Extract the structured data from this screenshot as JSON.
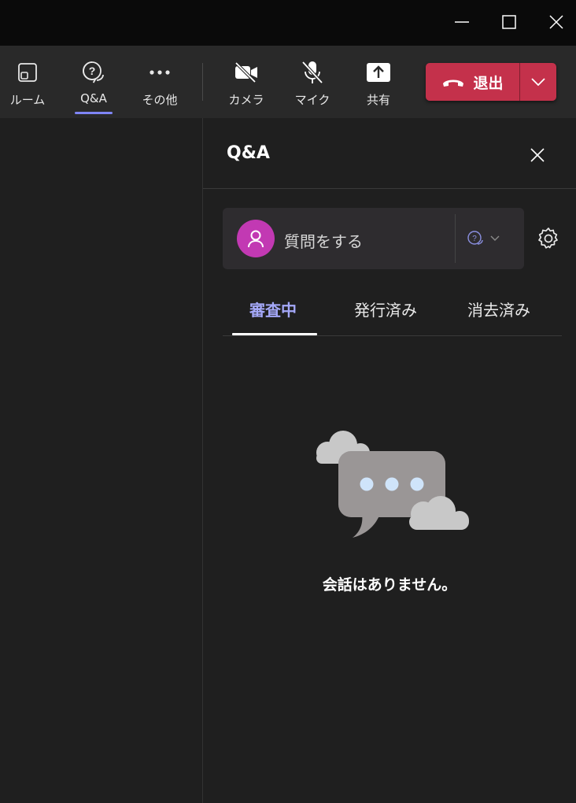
{
  "window": {
    "minimize_icon": "minimize-icon",
    "maximize_icon": "maximize-icon",
    "close_icon": "close-icon"
  },
  "toolbar": {
    "room_label": "ルーム",
    "qa_label": "Q&A",
    "more_label": "その他",
    "camera_label": "カメラ",
    "mic_label": "マイク",
    "share_label": "共有",
    "leave_label": "退出",
    "active_tab": "Q&A"
  },
  "panel": {
    "title": "Q&A",
    "ask_placeholder": "質問をする",
    "tabs": [
      {
        "label": "審査中",
        "active": true
      },
      {
        "label": "発行済み",
        "active": false
      },
      {
        "label": "消去済み",
        "active": false
      }
    ],
    "empty_message": "会話はありません。"
  },
  "colors": {
    "accent": "#7f85f5",
    "active_tab_text": "#a4a8f8",
    "leave_button": "#c4314b",
    "avatar": "#c239b3",
    "titlebar": "#0a0a0a",
    "toolbar": "#292929",
    "background": "#1f1f1f"
  }
}
